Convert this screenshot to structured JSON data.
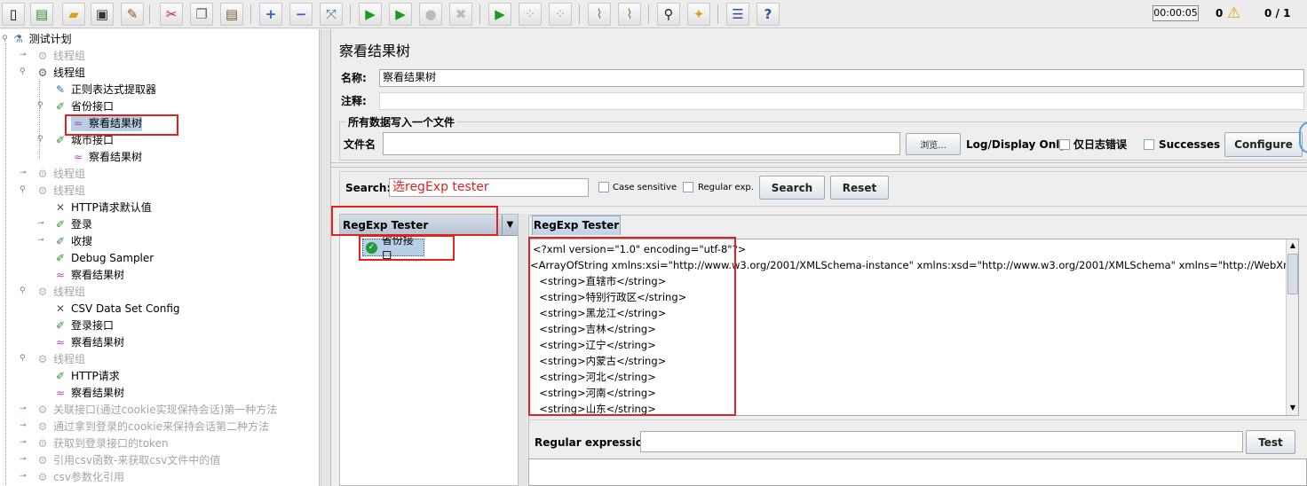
{
  "toolbar": {
    "timer": "00:00:05",
    "warnings": "0",
    "threads": "0 / 1",
    "icons": [
      "new-icon",
      "templates-icon",
      "open-icon",
      "save-icon",
      "save-as-icon",
      "cut-icon",
      "copy-icon",
      "paste-icon",
      "expand-icon",
      "collapse-icon",
      "toggle-icon",
      "start-icon",
      "start-no-pause-icon",
      "stop-icon",
      "shutdown-icon",
      "remote-start-icon",
      "remote-stop-icon",
      "remote-shutdown-icon",
      "clear-icon",
      "clear-all-icon",
      "search-icon",
      "reset-search-icon",
      "function-helper-icon",
      "help-icon"
    ]
  },
  "tree": {
    "root": "测试计划",
    "nodes": [
      {
        "label": "线程组",
        "disabled": true
      },
      {
        "label": "线程组",
        "disabled": false
      },
      {
        "label": "正则表达式提取器",
        "disabled": false
      },
      {
        "label": "省份接口",
        "disabled": false
      },
      {
        "label": "察看结果树",
        "disabled": false,
        "selected": true
      },
      {
        "label": "城市接口",
        "disabled": false
      },
      {
        "label": "察看结果树",
        "disabled": false
      },
      {
        "label": "线程组",
        "disabled": true
      },
      {
        "label": "线程组",
        "disabled": true
      },
      {
        "label": "HTTP请求默认值",
        "disabled": false
      },
      {
        "label": "登录",
        "disabled": false
      },
      {
        "label": "收搜",
        "disabled": false
      },
      {
        "label": "Debug Sampler",
        "disabled": false
      },
      {
        "label": "察看结果树",
        "disabled": false
      },
      {
        "label": "线程组",
        "disabled": true
      },
      {
        "label": "CSV Data Set Config",
        "disabled": false
      },
      {
        "label": "登录接口",
        "disabled": false
      },
      {
        "label": "察看结果树",
        "disabled": false
      },
      {
        "label": "线程组",
        "disabled": true
      },
      {
        "label": "HTTP请求",
        "disabled": false
      },
      {
        "label": "察看结果树",
        "disabled": false
      },
      {
        "label": "关联接口(通过cookie实现保持会话)第一种方法",
        "disabled": true
      },
      {
        "label": "通过拿到登录的cookie来保持会话第二种方法",
        "disabled": true
      },
      {
        "label": "获取到登录接口的token",
        "disabled": true
      },
      {
        "label": "引用csv函数-来获取csv文件中的值",
        "disabled": true
      },
      {
        "label": "csv参数化引用",
        "disabled": true
      }
    ]
  },
  "panel": {
    "title": "察看结果树",
    "name_label": "名称:",
    "name_value": "察看结果树",
    "comment_label": "注释:",
    "file_group_title": "所有数据写入一个文件",
    "filename_label": "文件名",
    "browse_label": "浏览...",
    "log_display_label": "Log/Display Only:",
    "errors_only_label": "仅日志错误",
    "successes_label": "Successes",
    "configure_label": "Configure"
  },
  "search": {
    "label": "Search:",
    "value": "选regExp tester",
    "case_sensitive_label": "Case sensitive",
    "regular_exp_label": "Regular exp.",
    "search_button": "Search",
    "reset_button": "Reset"
  },
  "results": {
    "renderer_selected": "RegExp Tester",
    "sample_label": "省份接口",
    "tab_label": "RegExp Tester",
    "response_lines": [
      "<?xml version=\"1.0\" encoding=\"utf-8\"?>",
      "<ArrayOfString xmlns:xsi=\"http://www.w3.org/2001/XMLSchema-instance\" xmlns:xsd=\"http://www.w3.org/2001/XMLSchema\" xmlns=\"http://WebXml.com.cn/\">",
      "  <string>直辖市</string>",
      "  <string>特别行政区</string>",
      "  <string>黑龙江</string>",
      "  <string>吉林</string>",
      "  <string>辽宁</string>",
      "  <string>内蒙古</string>",
      "  <string>河北</string>",
      "  <string>河南</string>",
      "  <string>山东</string>"
    ],
    "regex_label": "Regular expression:",
    "regex_value": "",
    "test_button": "Test"
  },
  "colors": {
    "highlight": "#e0231e",
    "selection": "#b8cfe5",
    "disabled_text": "#a4a4a4"
  }
}
